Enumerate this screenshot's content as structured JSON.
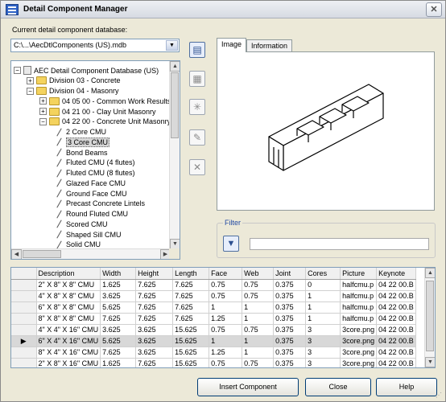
{
  "window": {
    "title": "Detail Component Manager",
    "close_glyph": "✕"
  },
  "database": {
    "label": "Current detail component database:",
    "value": "C:\\...\\AecDtlComponents (US).mdb"
  },
  "tree": {
    "items": [
      {
        "text": "AEC Detail Component Database (US)",
        "toggle": "−",
        "icon": "database-icon"
      },
      {
        "text": "Division 03 - Concrete",
        "toggle": "+",
        "icon": "folder-icon"
      },
      {
        "text": "Division 04 - Masonry",
        "toggle": "−",
        "icon": "folder-icon"
      },
      {
        "text": "04 05 00 - Common Work Results",
        "toggle": "+",
        "icon": "folder-icon"
      },
      {
        "text": "04 21 00 - Clay Unit Masonry",
        "toggle": "+",
        "icon": "folder-icon"
      },
      {
        "text": "04 22 00 - Concrete Unit Masonry",
        "toggle": "−",
        "icon": "folder-icon"
      },
      {
        "text": "2 Core CMU",
        "icon": "component-icon"
      },
      {
        "text": "3 Core CMU",
        "icon": "component-icon",
        "selected": true
      },
      {
        "text": "Bond Beams",
        "icon": "component-icon"
      },
      {
        "text": "Fluted CMU (4 flutes)",
        "icon": "component-icon"
      },
      {
        "text": "Fluted CMU (8 flutes)",
        "icon": "component-icon"
      },
      {
        "text": "Glazed Face CMU",
        "icon": "component-icon"
      },
      {
        "text": "Ground Face CMU",
        "icon": "component-icon"
      },
      {
        "text": "Precast Concrete Lintels",
        "icon": "component-icon"
      },
      {
        "text": "Round Fluted CMU",
        "icon": "component-icon"
      },
      {
        "text": "Scored CMU",
        "icon": "component-icon"
      },
      {
        "text": "Shaped Sill CMU",
        "icon": "component-icon"
      },
      {
        "text": "Solid CMU",
        "icon": "component-icon"
      }
    ],
    "scroll": {
      "up": "▲",
      "down": "▼",
      "left": "◀",
      "right": "▶"
    }
  },
  "side_buttons": [
    {
      "name": "database-button",
      "glyph": "▤",
      "active": true
    },
    {
      "name": "new-component-button",
      "glyph": "▦",
      "active": false
    },
    {
      "name": "edit-component-button",
      "glyph": "✳",
      "active": false
    },
    {
      "name": "copy-component-button",
      "glyph": "✎",
      "active": false
    },
    {
      "name": "delete-component-button",
      "glyph": "✕",
      "active": false
    }
  ],
  "tabs": [
    {
      "label": "Image",
      "active": true
    },
    {
      "label": "Information",
      "active": false
    }
  ],
  "filter": {
    "label": "Filter",
    "button_glyph": "▼",
    "value": ""
  },
  "grid": {
    "columns": [
      "",
      "Description",
      "Width",
      "Height",
      "Length",
      "Face",
      "Web",
      "Joint",
      "Cores",
      "Picture",
      "Keynote"
    ],
    "selected_row_marker": "▶",
    "rows": [
      [
        "2\" X 8\" X 8\" CMU",
        "1.625",
        "7.625",
        "7.625",
        "0.75",
        "0.75",
        "0.375",
        "0",
        "halfcmu.p",
        "04 22 00.B"
      ],
      [
        "4\" X 8\" X 8\" CMU",
        "3.625",
        "7.625",
        "7.625",
        "0.75",
        "0.75",
        "0.375",
        "1",
        "halfcmu.p",
        "04 22 00.B"
      ],
      [
        "6\" X 8\" X 8\" CMU",
        "5.625",
        "7.625",
        "7.625",
        "1",
        "1",
        "0.375",
        "1",
        "halfcmu.p",
        "04 22 00.B"
      ],
      [
        "8\" X 8\" X 8\" CMU",
        "7.625",
        "7.625",
        "7.625",
        "1.25",
        "1",
        "0.375",
        "1",
        "halfcmu.p",
        "04 22 00.B"
      ],
      [
        "4\" X 4\" X 16\" CMU",
        "3.625",
        "3.625",
        "15.625",
        "0.75",
        "0.75",
        "0.375",
        "3",
        "3core.png",
        "04 22 00.B"
      ],
      [
        "6\" X 4\" X 16\" CMU",
        "5.625",
        "3.625",
        "15.625",
        "1",
        "1",
        "0.375",
        "3",
        "3core.png",
        "04 22 00.B"
      ],
      [
        "8\" X 4\" X 16\" CMU",
        "7.625",
        "3.625",
        "15.625",
        "1.25",
        "1",
        "0.375",
        "3",
        "3core.png",
        "04 22 00.B"
      ],
      [
        "2\" X 8\" X 16\" CMU",
        "1.625",
        "7.625",
        "15.625",
        "0.75",
        "0.75",
        "0.375",
        "3",
        "3core.png",
        "04 22 00.B"
      ]
    ],
    "selected_row": 5,
    "scroll": {
      "up": "▲",
      "down": "▼"
    }
  },
  "buttons": {
    "insert": "Insert Component",
    "close": "Close",
    "help": "Help"
  },
  "colors": {
    "accent": "#2149a3",
    "selection": "#d8d8d8"
  }
}
